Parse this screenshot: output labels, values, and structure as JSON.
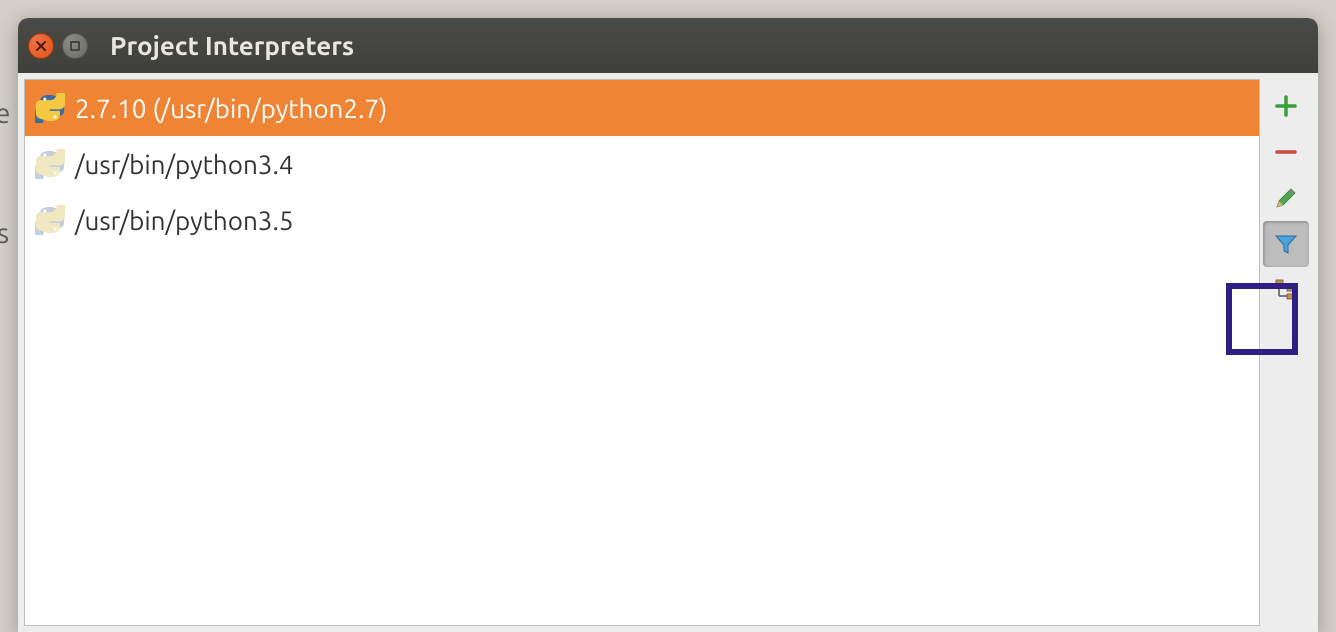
{
  "window": {
    "title": "Project Interpreters"
  },
  "interpreters": [
    {
      "label": "2.7.10 (/usr/bin/python2.7)",
      "selected": true,
      "active": true
    },
    {
      "label": "/usr/bin/python3.4",
      "selected": false,
      "active": false
    },
    {
      "label": "/usr/bin/python3.5",
      "selected": false,
      "active": false
    }
  ],
  "toolbar": {
    "add": "+",
    "remove": "−",
    "edit": "edit",
    "filter": "filter",
    "paths": "paths"
  },
  "background": {
    "char1": "e",
    "char2": "s"
  }
}
